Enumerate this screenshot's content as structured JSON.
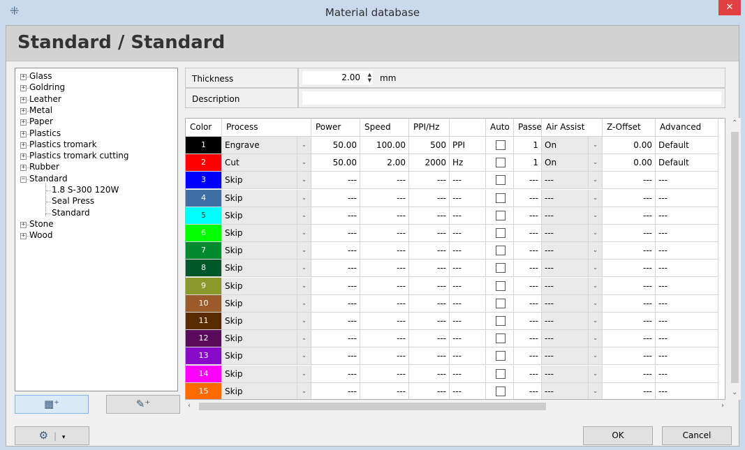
{
  "window": {
    "title": "Material database",
    "close_label": "✕",
    "app_icon": "laser-icon"
  },
  "header": {
    "title": "Standard / Standard"
  },
  "tree": {
    "items": [
      {
        "label": "Glass",
        "level": 0,
        "expander": "+"
      },
      {
        "label": "Goldring",
        "level": 0,
        "expander": "+"
      },
      {
        "label": "Leather",
        "level": 0,
        "expander": "+"
      },
      {
        "label": "Metal",
        "level": 0,
        "expander": "+"
      },
      {
        "label": "Paper",
        "level": 0,
        "expander": "+"
      },
      {
        "label": "Plastics",
        "level": 0,
        "expander": "+"
      },
      {
        "label": "Plastics tromark",
        "level": 0,
        "expander": "+"
      },
      {
        "label": "Plastics tromark cutting",
        "level": 0,
        "expander": "+"
      },
      {
        "label": "Rubber",
        "level": 0,
        "expander": "+"
      },
      {
        "label": "Standard",
        "level": 0,
        "expander": "−"
      },
      {
        "label": "1.8 S-300 120W",
        "level": 1,
        "expander": ""
      },
      {
        "label": "Seal Press",
        "level": 1,
        "expander": ""
      },
      {
        "label": "Standard",
        "level": 1,
        "expander": ""
      },
      {
        "label": "Stone",
        "level": 0,
        "expander": "+"
      },
      {
        "label": "Wood",
        "level": 0,
        "expander": "+"
      }
    ]
  },
  "tree_buttons": {
    "add_material_icon": "add-material-icon",
    "add_process_icon": "add-process-icon"
  },
  "properties": {
    "thickness_label": "Thickness",
    "thickness_value": "2.00",
    "thickness_unit": "mm",
    "description_label": "Description",
    "description_value": ""
  },
  "grid": {
    "columns": [
      "Color",
      "Process",
      "Power",
      "Speed",
      "PPI/Hz",
      "",
      "Auto",
      "Passes",
      "Air Assist",
      "Z-Offset",
      "Advanced"
    ],
    "rows": [
      {
        "color": "1",
        "bg": "#000000",
        "fg": "#ffffff",
        "process": "Engrave",
        "power": "50.00",
        "speed": "100.00",
        "ppi": "500",
        "unit": "PPI",
        "passes": "1",
        "air": "On",
        "z": "0.00",
        "adv": "Default"
      },
      {
        "color": "2",
        "bg": "#ff0000",
        "fg": "#ffffff",
        "process": "Cut",
        "power": "50.00",
        "speed": "2.00",
        "ppi": "2000",
        "unit": "Hz",
        "passes": "1",
        "air": "On",
        "z": "0.00",
        "adv": "Default"
      },
      {
        "color": "3",
        "bg": "#0000ff",
        "fg": "#ffffff",
        "process": "Skip",
        "power": "---",
        "speed": "---",
        "ppi": "---",
        "unit": "---",
        "passes": "---",
        "air": "---",
        "z": "---",
        "adv": "---"
      },
      {
        "color": "4",
        "bg": "#3e6ea3",
        "fg": "#ffffff",
        "process": "Skip",
        "power": "---",
        "speed": "---",
        "ppi": "---",
        "unit": "---",
        "passes": "---",
        "air": "---",
        "z": "---",
        "adv": "---"
      },
      {
        "color": "5",
        "bg": "#00ffff",
        "fg": "#333333",
        "process": "Skip",
        "power": "---",
        "speed": "---",
        "ppi": "---",
        "unit": "---",
        "passes": "---",
        "air": "---",
        "z": "---",
        "adv": "---"
      },
      {
        "color": "6",
        "bg": "#00ff00",
        "fg": "#ffffff",
        "process": "Skip",
        "power": "---",
        "speed": "---",
        "ppi": "---",
        "unit": "---",
        "passes": "---",
        "air": "---",
        "z": "---",
        "adv": "---"
      },
      {
        "color": "7",
        "bg": "#008a2e",
        "fg": "#ffffff",
        "process": "Skip",
        "power": "---",
        "speed": "---",
        "ppi": "---",
        "unit": "---",
        "passes": "---",
        "air": "---",
        "z": "---",
        "adv": "---"
      },
      {
        "color": "8",
        "bg": "#00582a",
        "fg": "#ffffff",
        "process": "Skip",
        "power": "---",
        "speed": "---",
        "ppi": "---",
        "unit": "---",
        "passes": "---",
        "air": "---",
        "z": "---",
        "adv": "---"
      },
      {
        "color": "9",
        "bg": "#8a9a2a",
        "fg": "#ffffff",
        "process": "Skip",
        "power": "---",
        "speed": "---",
        "ppi": "---",
        "unit": "---",
        "passes": "---",
        "air": "---",
        "z": "---",
        "adv": "---"
      },
      {
        "color": "10",
        "bg": "#9a5a2a",
        "fg": "#ffffff",
        "process": "Skip",
        "power": "---",
        "speed": "---",
        "ppi": "---",
        "unit": "---",
        "passes": "---",
        "air": "---",
        "z": "---",
        "adv": "---"
      },
      {
        "color": "11",
        "bg": "#5a2a00",
        "fg": "#ffffff",
        "process": "Skip",
        "power": "---",
        "speed": "---",
        "ppi": "---",
        "unit": "---",
        "passes": "---",
        "air": "---",
        "z": "---",
        "adv": "---"
      },
      {
        "color": "12",
        "bg": "#5a0a5a",
        "fg": "#ffffff",
        "process": "Skip",
        "power": "---",
        "speed": "---",
        "ppi": "---",
        "unit": "---",
        "passes": "---",
        "air": "---",
        "z": "---",
        "adv": "---"
      },
      {
        "color": "13",
        "bg": "#8a0aca",
        "fg": "#ffffff",
        "process": "Skip",
        "power": "---",
        "speed": "---",
        "ppi": "---",
        "unit": "---",
        "passes": "---",
        "air": "---",
        "z": "---",
        "adv": "---"
      },
      {
        "color": "14",
        "bg": "#ff00ff",
        "fg": "#ffffff",
        "process": "Skip",
        "power": "---",
        "speed": "---",
        "ppi": "---",
        "unit": "---",
        "passes": "---",
        "air": "---",
        "z": "---",
        "adv": "---"
      },
      {
        "color": "15",
        "bg": "#ff6a00",
        "fg": "#ffffff",
        "process": "Skip",
        "power": "---",
        "speed": "---",
        "ppi": "---",
        "unit": "---",
        "passes": "---",
        "air": "---",
        "z": "---",
        "adv": "---"
      }
    ]
  },
  "footer": {
    "settings_icon": "gear-icon",
    "dropdown_icon": "chevron-down-icon",
    "ok_label": "OK",
    "cancel_label": "Cancel"
  }
}
